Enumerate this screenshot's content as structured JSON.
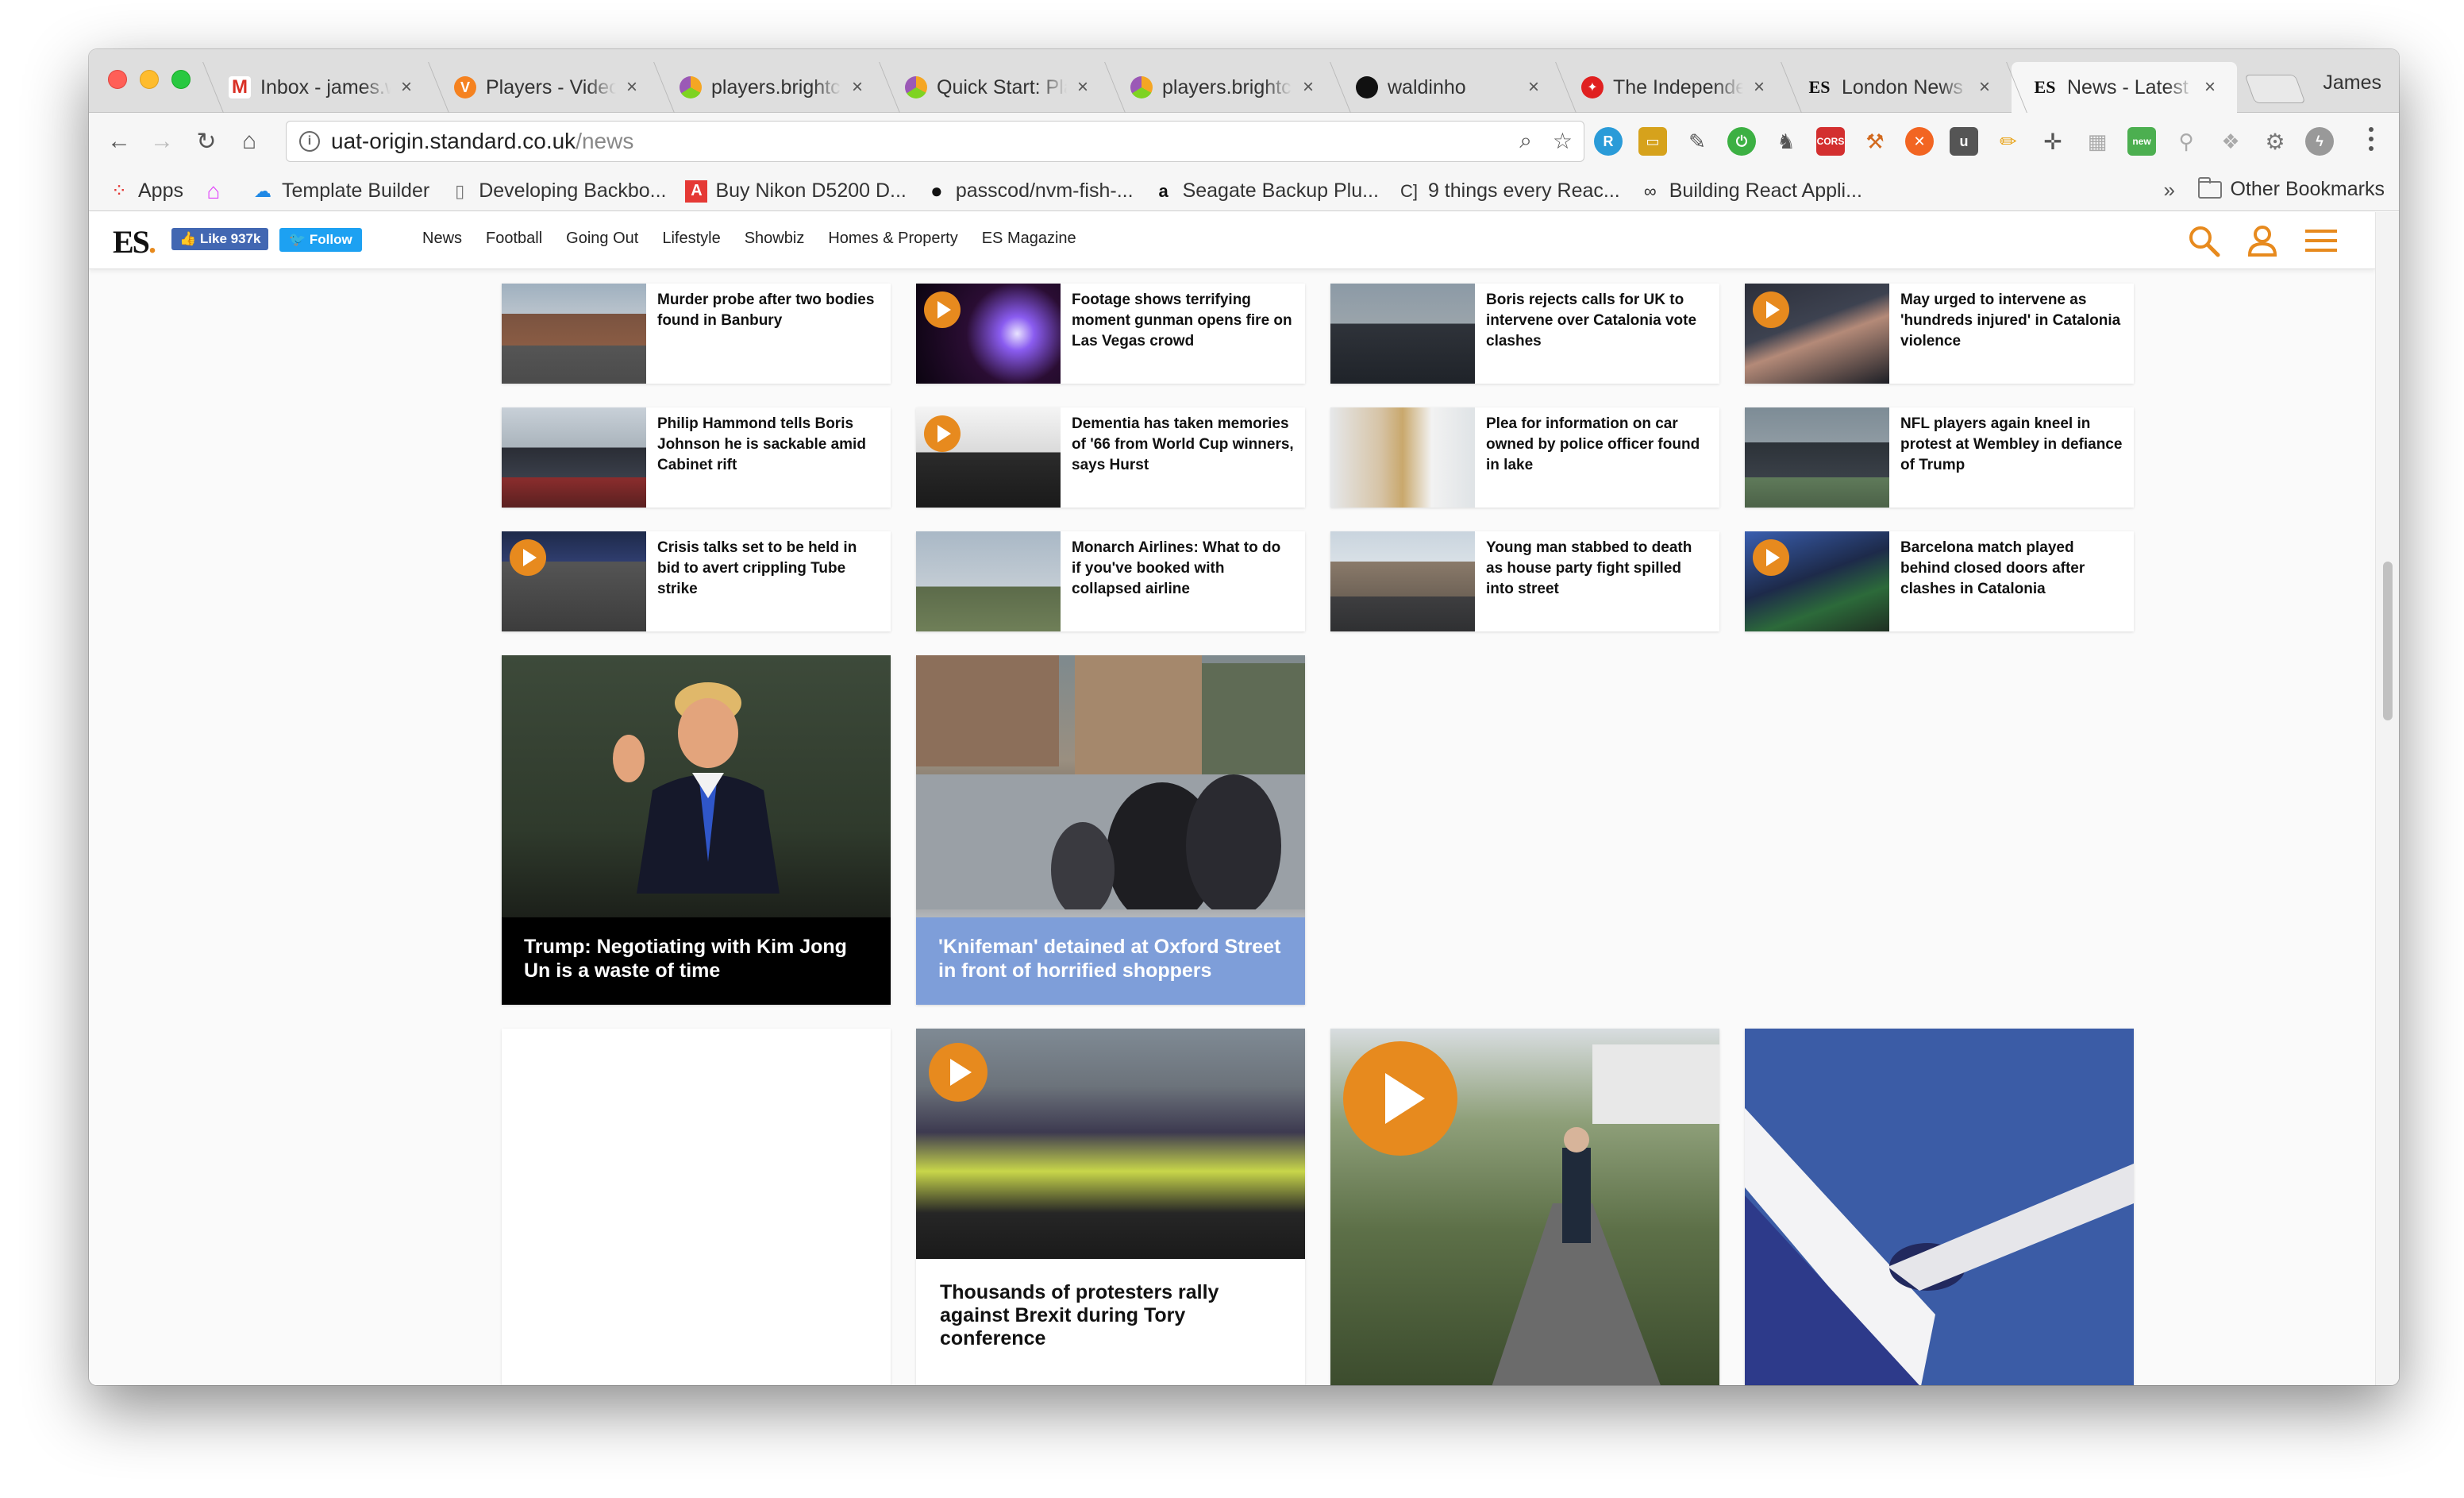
{
  "browser": {
    "tabs": [
      {
        "title": "Inbox - james.w",
        "favicon": "gmail-icon",
        "color": "#d93025",
        "glyph": "M"
      },
      {
        "title": "Players - Video",
        "favicon": "brightcove-icon",
        "color": "#f58220",
        "glyph": "V"
      },
      {
        "title": "players.brightc",
        "favicon": "brightcove-hex-icon",
        "color": "#7b5ea7",
        "glyph": "◆"
      },
      {
        "title": "Quick Start: Pla",
        "favicon": "brightcove-hex-icon",
        "color": "#7b5ea7",
        "glyph": "◆"
      },
      {
        "title": "players.brightc",
        "favicon": "brightcove-hex-icon",
        "color": "#7b5ea7",
        "glyph": "◆"
      },
      {
        "title": "waldinho",
        "favicon": "github-icon",
        "color": "#111111",
        "glyph": "●"
      },
      {
        "title": "The Independe",
        "favicon": "independent-eagle-icon",
        "color": "#e02020",
        "glyph": "✦"
      },
      {
        "title": "London News |",
        "favicon": "es-logo-icon",
        "color": "#ffffff",
        "glyph": "ES"
      },
      {
        "title": "News - Latest n",
        "favicon": "es-logo-icon",
        "color": "#ffffff",
        "glyph": "ES"
      }
    ],
    "profile_name": "James",
    "url_host": "uat-origin.standard.co.uk",
    "url_path": "/news",
    "bookmarks": [
      {
        "label": "Apps",
        "icon": "apps-grid-icon"
      },
      {
        "label": "",
        "icon": "pink-home-icon"
      },
      {
        "label": "Template Builder",
        "icon": "cloud-icon"
      },
      {
        "label": "Developing Backbo...",
        "icon": "page-icon"
      },
      {
        "label": "Buy Nikon D5200 D...",
        "icon": "adobe-icon"
      },
      {
        "label": "passcod/nvm-fish-...",
        "icon": "github-icon"
      },
      {
        "label": "Seagate Backup Plu...",
        "icon": "amazon-icon"
      },
      {
        "label": "9 things every Reac...",
        "icon": "bracket-icon"
      },
      {
        "label": "Building React Appli...",
        "icon": "glasses-icon"
      }
    ],
    "bookmarks_more": "»",
    "other_bookmarks": "Other Bookmarks"
  },
  "site": {
    "logo_text": "ES",
    "logo_dot": ".",
    "fb_like": "👍 Like 937k",
    "tw_follow": "🐦 Follow",
    "nav": [
      "News",
      "Football",
      "Going Out",
      "Lifestyle",
      "Showbiz",
      "Homes & Property",
      "ES Magazine"
    ],
    "accent": "#e78a1e"
  },
  "small_cards": [
    {
      "title": "Murder probe after two bodies found in Banbury",
      "video": false
    },
    {
      "title": "Footage shows terrifying moment gunman opens fire on Las Vegas crowd",
      "video": true
    },
    {
      "title": "Boris rejects calls for UK to intervene over Catalonia vote clashes",
      "video": false
    },
    {
      "title": "May urged to intervene as 'hundreds injured' in Catalonia violence",
      "video": true
    },
    {
      "title": "Philip Hammond tells Boris Johnson he is sackable amid Cabinet rift",
      "video": false
    },
    {
      "title": "Dementia has taken memories of '66 from World Cup winners, says Hurst",
      "video": true
    },
    {
      "title": "Plea for information on car owned by police officer found in lake",
      "video": false
    },
    {
      "title": "NFL players again kneel in protest at Wembley in defiance of Trump",
      "video": false
    },
    {
      "title": "Crisis talks set to be held in bid to avert crippling Tube strike",
      "video": true
    },
    {
      "title": "Monarch Airlines: What to do if you've booked with collapsed airline",
      "video": false
    },
    {
      "title": "Young man stabbed to death as house party fight spilled into street",
      "video": false
    },
    {
      "title": "Barcelona match played behind closed doors after clashes in Catalonia",
      "video": true
    }
  ],
  "features": [
    {
      "title": "Trump: Negotiating with Kim Jong Un is a waste of time",
      "caption_bg": "#000000"
    },
    {
      "title": "'Knifeman' detained at Oxford Street in front of horrified shoppers",
      "caption_bg": "#7e9ed9"
    }
  ],
  "bottom_cards": {
    "protest": {
      "title": "Thousands of protesters rally against Brexit during Tory conference",
      "video": true
    }
  }
}
